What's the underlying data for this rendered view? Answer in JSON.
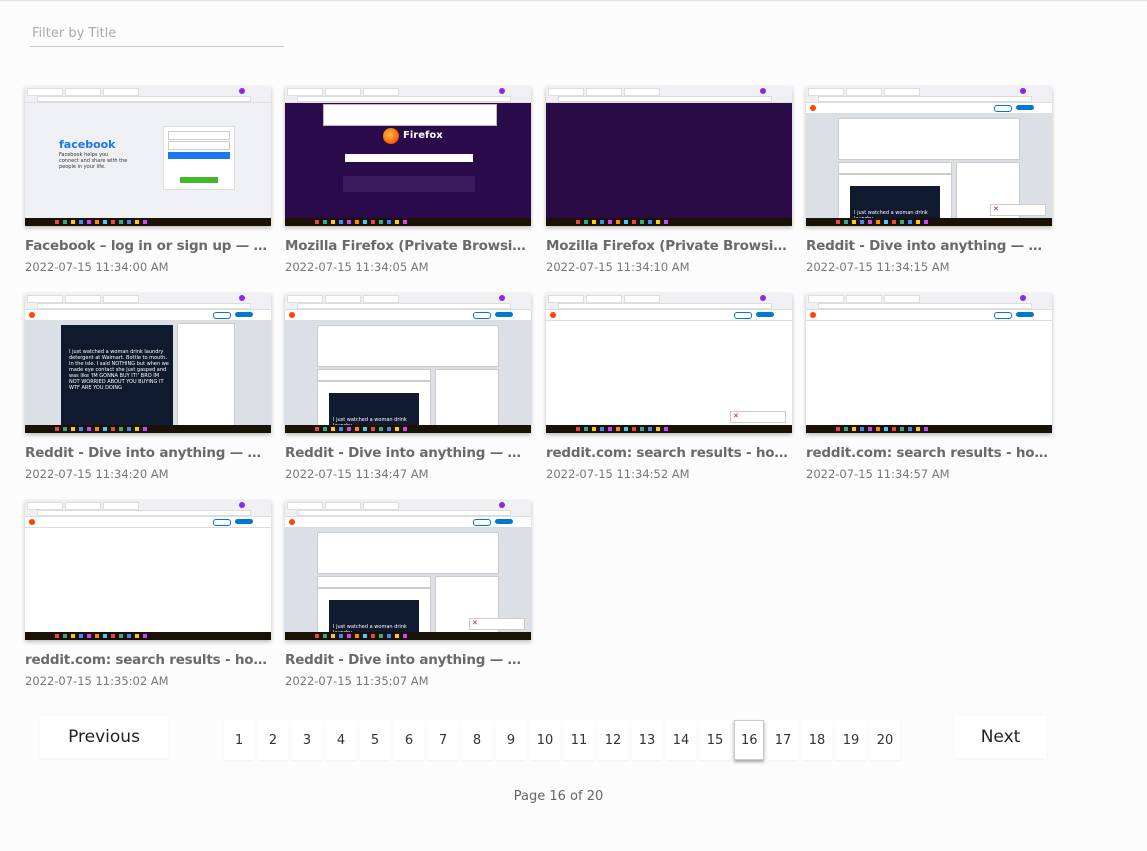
{
  "filter": {
    "placeholder": "Filter by Title",
    "value": ""
  },
  "cards": [
    {
      "title": "Facebook – log in or sign up — Moz...",
      "time": "2022-07-15 11:34:00 AM",
      "thumb": "facebook-login"
    },
    {
      "title": "Mozilla Firefox (Private Browsing)",
      "time": "2022-07-15 11:34:05 AM",
      "thumb": "firefox-private"
    },
    {
      "title": "Mozilla Firefox (Private Browsing)",
      "time": "2022-07-15 11:34:10 AM",
      "thumb": "dark-blank"
    },
    {
      "title": "Reddit - Dive into anything — Mozill...",
      "time": "2022-07-15 11:34:15 AM",
      "thumb": "reddit-feed"
    },
    {
      "title": "Reddit - Dive into anything — Mozill...",
      "time": "2022-07-15 11:34:20 AM",
      "thumb": "reddit-post"
    },
    {
      "title": "Reddit - Dive into anything — Mozill...",
      "time": "2022-07-15 11:34:47 AM",
      "thumb": "reddit-feed"
    },
    {
      "title": "reddit.com: search results - hot+gi...",
      "time": "2022-07-15 11:34:52 AM",
      "thumb": "reddit-blank"
    },
    {
      "title": "reddit.com: search results - hot+gi...",
      "time": "2022-07-15 11:34:57 AM",
      "thumb": "reddit-blank"
    },
    {
      "title": "reddit.com: search results - hot+gi...",
      "time": "2022-07-15 11:35:02 AM",
      "thumb": "reddit-blank"
    },
    {
      "title": "Reddit - Dive into anything — Mozill...",
      "time": "2022-07-15 11:35:07 AM",
      "thumb": "reddit-feed"
    }
  ],
  "thumb_text": {
    "facebook_logo": "facebook",
    "facebook_tagline": "Facebook helps you connect and share with the people in your life.",
    "firefox_word": "Firefox",
    "reddit_post_text": "I just watched a woman drink laundry detergent at Walmart. Bottle to mouth. In the isle. I said NOTHING but when we made eye contact she just gasped and was like 'IM GONNA BUY IT!' BRO IM NOT WORRIED ABOUT YOU BUYING IT WTF ARE YOU DOING",
    "reddit_feed_text": "I just watched a woman drink laundry"
  },
  "pagination": {
    "previous_label": "Previous",
    "next_label": "Next",
    "pages": [
      "1",
      "2",
      "3",
      "4",
      "5",
      "6",
      "7",
      "8",
      "9",
      "10",
      "11",
      "12",
      "13",
      "14",
      "15",
      "16",
      "17",
      "18",
      "19",
      "20"
    ],
    "current": 16,
    "info": "Page 16 of 20"
  }
}
